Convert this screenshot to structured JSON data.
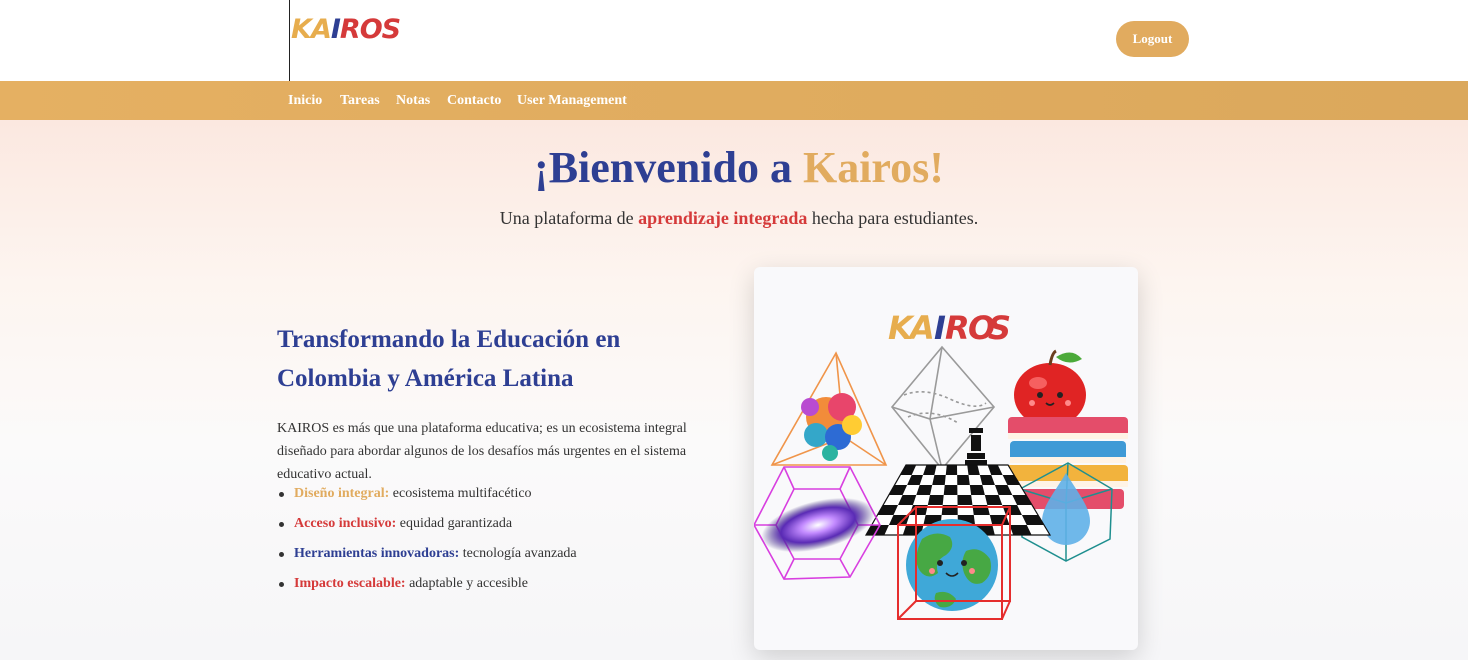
{
  "header": {
    "logo_letters": [
      "K",
      "A",
      "I",
      "R",
      "O",
      "S"
    ],
    "logo_colors": [
      "#e7ad4e",
      "#e7ad4e",
      "#2e3f93",
      "#d53a3a",
      "#d53a3a",
      "#d53a3a"
    ],
    "logout_label": "Logout"
  },
  "nav": {
    "items": [
      {
        "label": "Inicio"
      },
      {
        "label": "Tareas"
      },
      {
        "label": "Notas"
      },
      {
        "label": "Contacto"
      },
      {
        "label": "User Management"
      }
    ]
  },
  "hero": {
    "title_part1": "¡Bienvenido a",
    "title_part2": "Kairos!",
    "subtitle_part1": "Una plataforma de",
    "subtitle_highlight": "aprendizaje integrada",
    "subtitle_part2": "hecha para estudiantes."
  },
  "content": {
    "title": "Transformando la Educación en Colombia y América Latina",
    "description": "KAIROS es más que una plataforma educativa; es un ecosistema integral diseñado para abordar algunos de los desafíos más urgentes en el sistema educativo actual.",
    "features": [
      {
        "label": "Diseño integral:",
        "text": "ecosistema multifacético",
        "color": "#e1ab5f"
      },
      {
        "label": "Acceso inclusivo:",
        "text": "equidad garantizada",
        "color": "#d53a3a"
      },
      {
        "label": "Herramientas innovadoras:",
        "text": "tecnología avanzada",
        "color": "#2e3f93"
      },
      {
        "label": "Impacto escalable:",
        "text": "adaptable y accesible",
        "color": "#d53a3a"
      }
    ]
  },
  "illustration": {
    "logo_letters": [
      "K",
      "A",
      "I",
      "R",
      "O",
      "S"
    ]
  },
  "colors": {
    "accent": "#e1ab5f",
    "brand_blue": "#2e3f93",
    "brand_red": "#d53a3a"
  }
}
